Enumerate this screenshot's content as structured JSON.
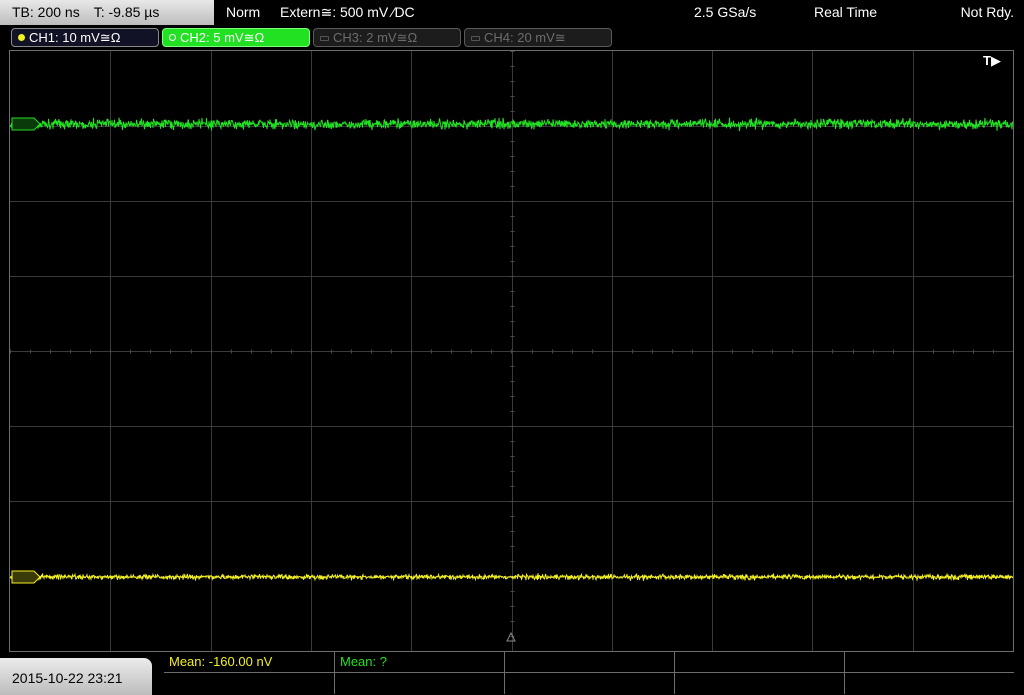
{
  "header": {
    "timebase": "TB: 200 ns",
    "trigger_time": "T: -9.85 µs",
    "trigger_mode": "Norm",
    "trigger_source": "Extern≅: 500 mV ∕DC",
    "sample_rate": "2.5 GSa/s",
    "acquisition_mode": "Real Time",
    "run_state": "Not Rdy."
  },
  "channels": [
    {
      "label": "CH1: 10 mV≅Ω",
      "color": "#f3f020",
      "active": true
    },
    {
      "label": "CH2: 5 mV≅Ω",
      "color": "#22e022",
      "active": true,
      "selected": true
    },
    {
      "label": "CH3: 2 mV≅Ω",
      "color": "#6c6c6c",
      "active": false
    },
    {
      "label": "CH4: 20 mV≅",
      "color": "#6c6c6c",
      "active": false
    }
  ],
  "screen": {
    "trigger_marker": "T▶",
    "grid_divisions": {
      "horizontal": 10,
      "vertical": 8
    },
    "grid_color": "#3a3a3a",
    "background": "#000000"
  },
  "footer": {
    "datetime": "2015-10-22 23:21",
    "measurements": [
      {
        "label": "Mean: -160.00 nV",
        "color": "#f3f020"
      },
      {
        "label": "Mean: ?",
        "color": "#22e022"
      }
    ]
  }
}
